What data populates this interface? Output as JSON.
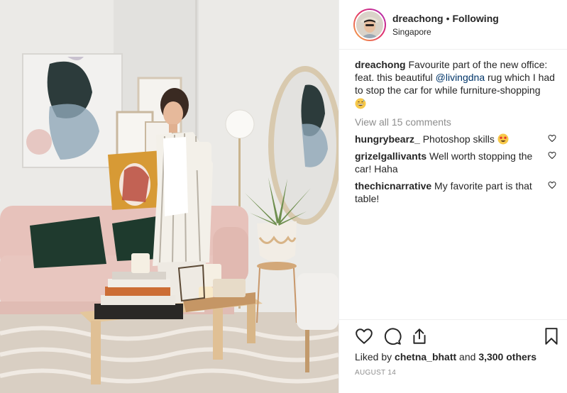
{
  "post": {
    "username": "dreachong",
    "separator": "•",
    "follow_status": "Following",
    "location": "Singapore"
  },
  "caption": {
    "username": "dreachong",
    "text_before_mention": " Favourite part of the new office: feat. this beautiful ",
    "mention": "@livingdna",
    "text_after_mention": " rug which I had to stop the car for while furniture-shopping",
    "emoji": "grinning-sweat-emoji"
  },
  "view_all_comments": "View all 15 comments",
  "comments": [
    {
      "username": "hungrybearz_",
      "text": " Photoshop skills ",
      "emoji": "star-struck-emoji"
    },
    {
      "username": "grizelgallivants",
      "text": " Well worth stopping the car! Haha"
    },
    {
      "username": "thechicnarrative",
      "text": " My favorite part is that table!"
    }
  ],
  "likes": {
    "prefix": "Liked by ",
    "user": "chetna_bhatt",
    "middle": " and ",
    "count": "3,300 others"
  },
  "date": "AUGUST 14",
  "icons": {
    "like": "heart-icon",
    "comment": "comment-bubble-icon",
    "share": "share-icon",
    "save": "bookmark-icon"
  },
  "colors": {
    "text": "#262626",
    "secondary": "#8e8e8e",
    "mention": "#003569",
    "border": "#efefef"
  }
}
